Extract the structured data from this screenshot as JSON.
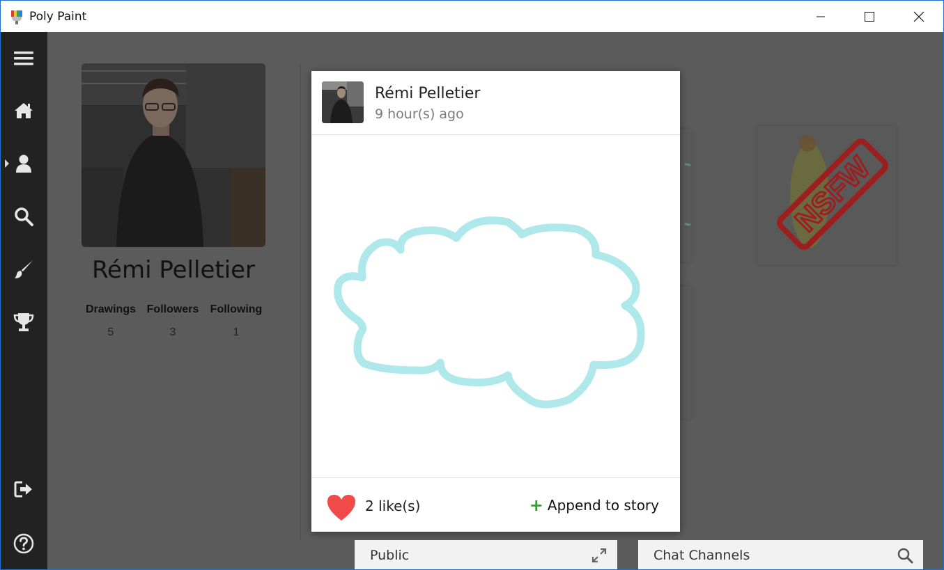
{
  "window": {
    "title": "Poly Paint"
  },
  "sidebar": {
    "items": [
      {
        "name": "menu-icon"
      },
      {
        "name": "home-icon"
      },
      {
        "name": "user-icon",
        "active": true
      },
      {
        "name": "search-icon"
      },
      {
        "name": "brush-icon"
      },
      {
        "name": "trophy-icon"
      },
      {
        "name": "logout-icon"
      },
      {
        "name": "help-icon"
      }
    ]
  },
  "profile": {
    "name": "Rémi Pelletier",
    "stats": [
      {
        "label": "Drawings",
        "value": "5"
      },
      {
        "label": "Followers",
        "value": "3"
      },
      {
        "label": "Following",
        "value": "1"
      }
    ]
  },
  "post": {
    "author": "Rémi Pelletier",
    "time": "9 hour(s) ago",
    "likes": "2 like(s)",
    "append_label": "Append to story",
    "stroke_color": "#aee8ea",
    "like_color": "#f04a4a"
  },
  "background_card": {
    "stamp_text": "NSFW",
    "stamp_color": "#9c1f1f"
  },
  "chat": {
    "public_label": "Public",
    "channels_label": "Chat Channels"
  }
}
